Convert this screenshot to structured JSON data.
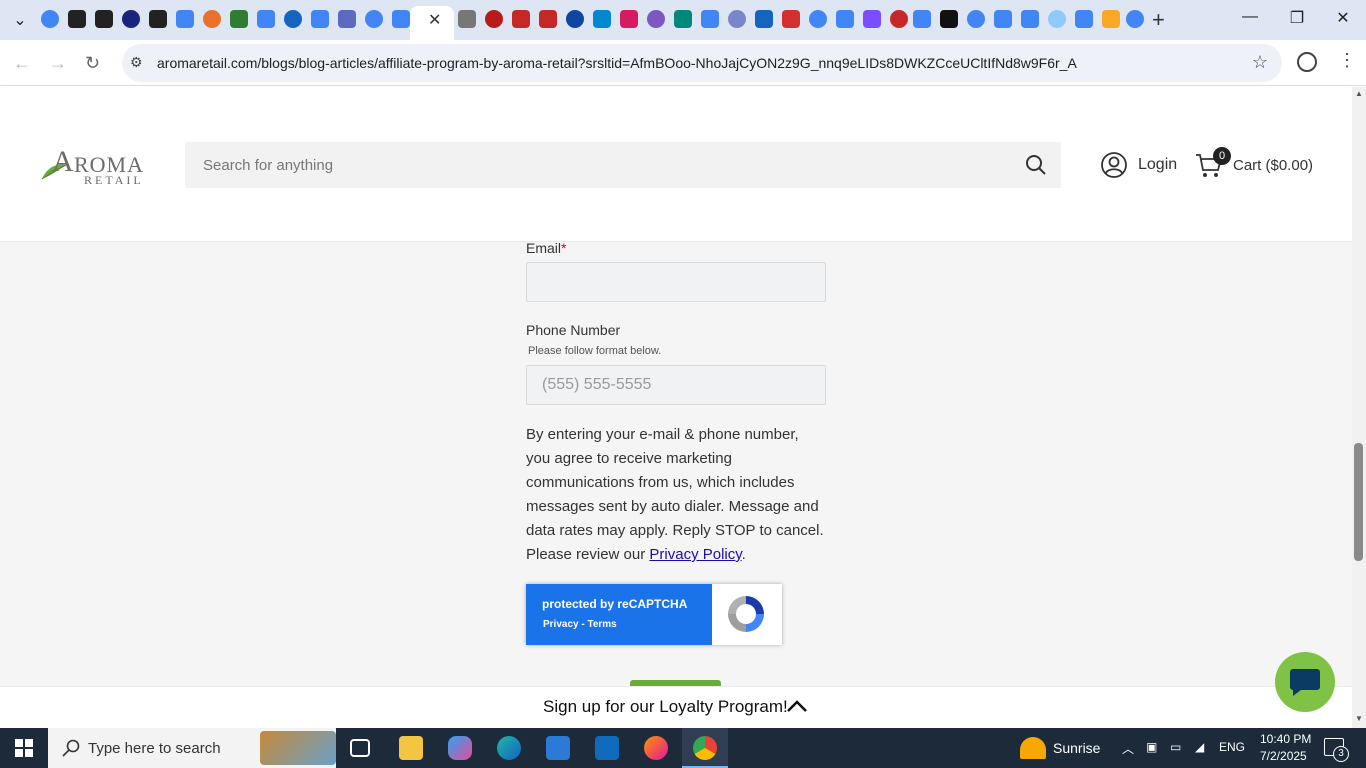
{
  "browser": {
    "url": "aromaretail.com/blogs/blog-articles/affiliate-program-by-aroma-retail?srsltid=AfmBOoo-NhoJajCyON2z9G_nnq9eLIDs8DWKZCceUCltIfNd8w9F6r_A",
    "tab_count_visible": 43
  },
  "header": {
    "logo_initial": "A",
    "logo_word": "ROMA",
    "logo_sub": "RETAIL",
    "search_placeholder": "Search for anything",
    "login_label": "Login",
    "cart_count": "0",
    "cart_label": "Cart ($0.00)"
  },
  "form": {
    "email_label": "Email",
    "email_required_mark": "*",
    "phone_label": "Phone Number",
    "phone_hint": "Please follow format below.",
    "phone_placeholder": "(555) 555-5555",
    "consent_text": "By entering your e-mail & phone number, you agree to receive marketing communications from us, which includes messages sent by auto dialer. Message and data rates may apply. Reply STOP to cancel. Please review our ",
    "privacy_link": "Privacy Policy",
    "consent_end": "."
  },
  "recaptcha": {
    "title": "protected by reCAPTCHA",
    "links": "Privacy - Terms"
  },
  "loyalty": {
    "text": "Sign up for our Loyalty Program!"
  },
  "taskbar": {
    "search_text": "Type here to search",
    "weather": "Sunrise",
    "language": "ENG",
    "time": "10:40 PM",
    "date": "7/2/2025",
    "notification_count": "3"
  },
  "colors": {
    "brand_green": "#7fc245",
    "recaptcha_blue": "#1a73e8",
    "link_blue": "#1a0dab",
    "required_red": "#d0021b"
  }
}
